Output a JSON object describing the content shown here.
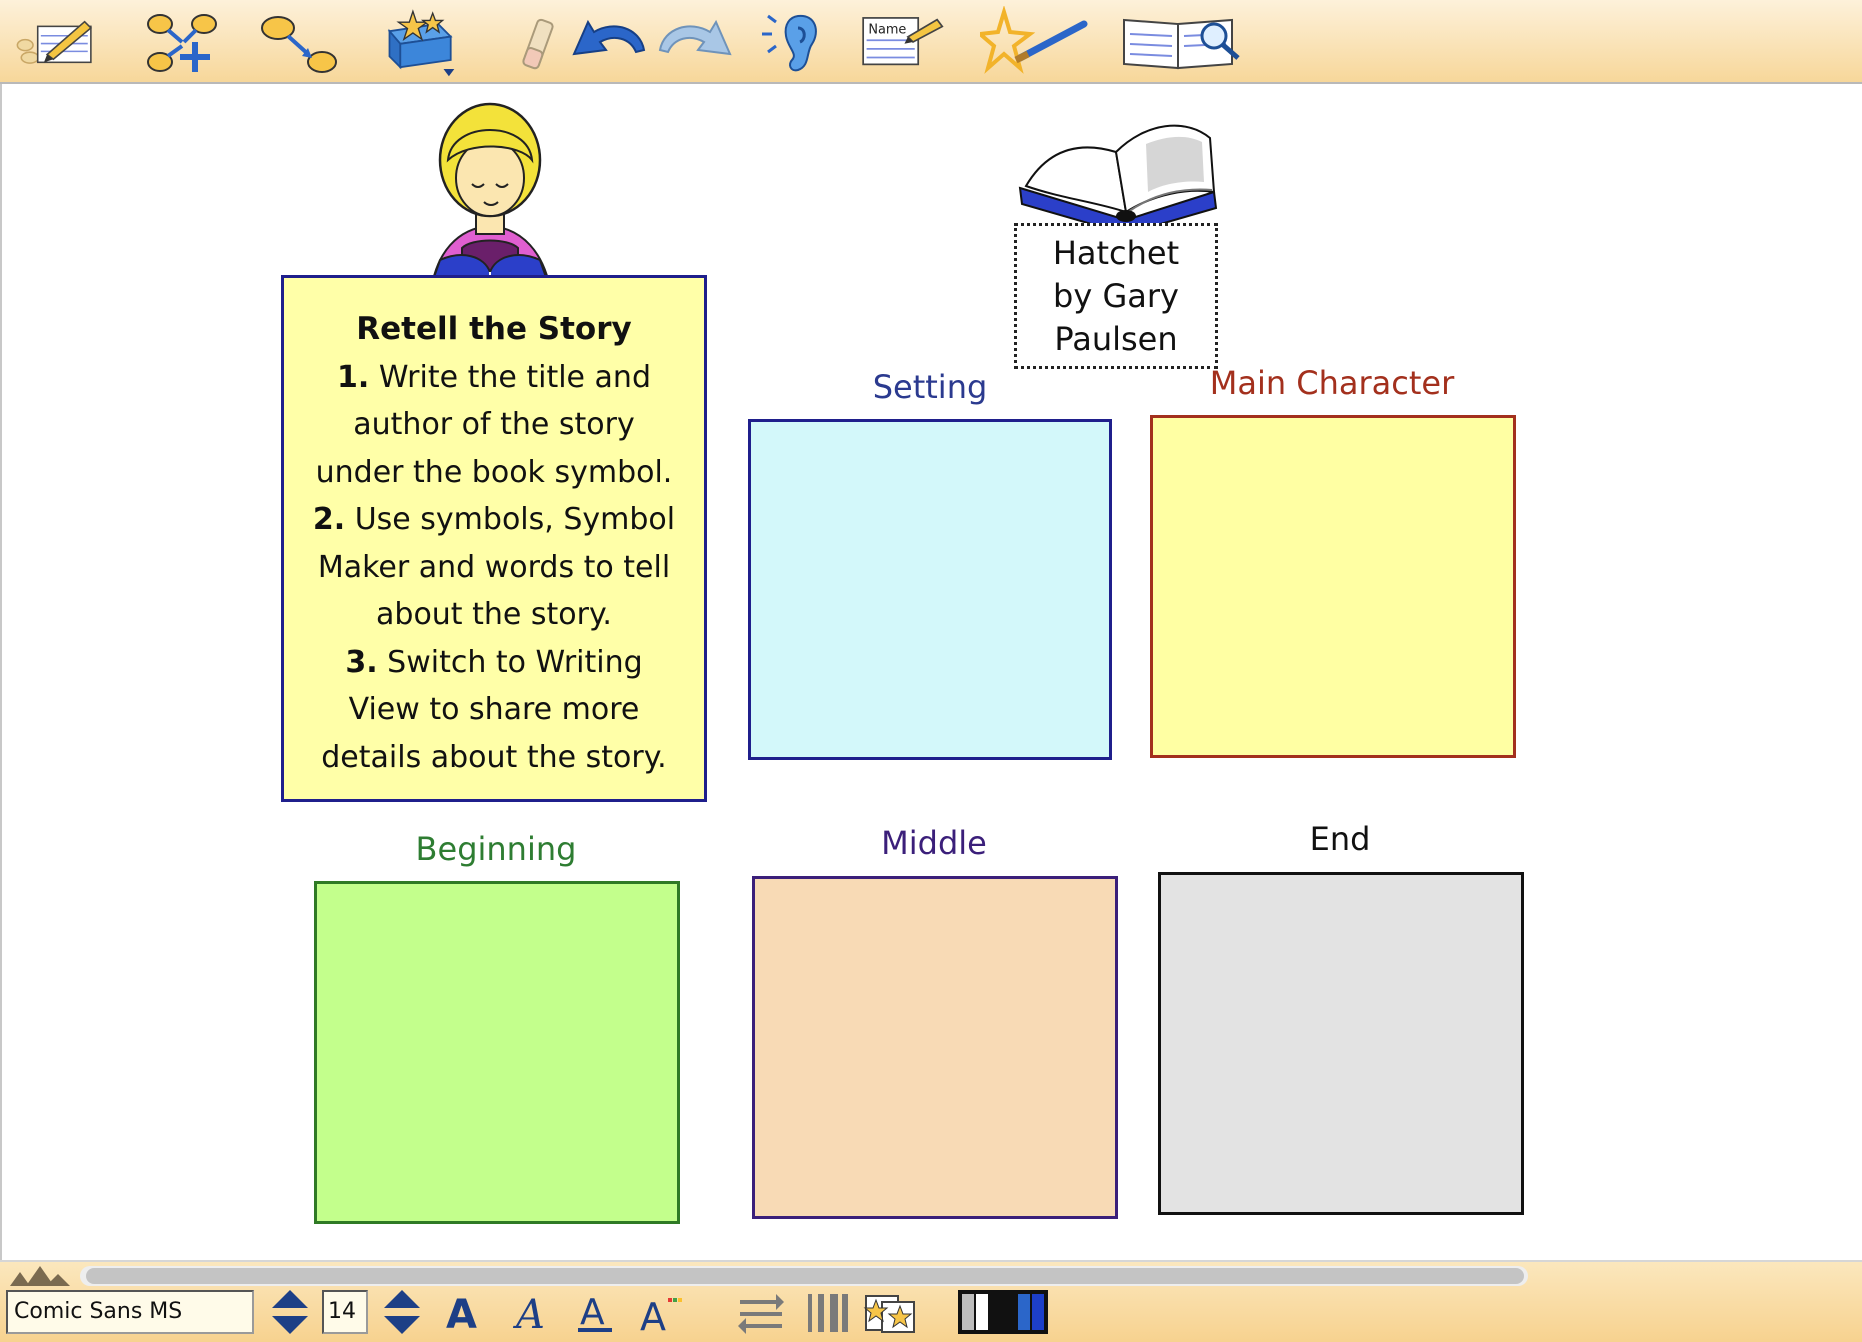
{
  "toolbar": {
    "icons": [
      "write-note-icon",
      "rapid-fire-icon",
      "create-link-icon",
      "symbols-icon",
      "eraser-icon",
      "undo-icon",
      "redo-icon",
      "listen-icon",
      "name-icon",
      "symbol-maker-icon",
      "writing-view-icon"
    ]
  },
  "instructions": {
    "title": "Retell the Story",
    "lines": [
      "Write the title and",
      "author of the story",
      "under the book symbol.",
      "Use symbols, Symbol",
      "Maker and words to tell",
      "about the story.",
      "Switch to Writing",
      "View to share more",
      "details about the story."
    ],
    "num1": "1.",
    "num2": "2.",
    "num3": "3."
  },
  "book": {
    "line1": "Hatchet",
    "line2": "by Gary",
    "line3": "Paulsen"
  },
  "boxes": {
    "setting": {
      "label": "Setting",
      "label_color": "#2b3a8f",
      "fill": "#d3f8fa",
      "border": "#1f1f8c"
    },
    "main_character": {
      "label": "Main Character",
      "label_color": "#a3301d",
      "fill": "#ffffa3",
      "border": "#a3301d"
    },
    "beginning": {
      "label": "Beginning",
      "label_color": "#2e7d32",
      "fill": "#c3ff8c",
      "border": "#2f7a25"
    },
    "middle": {
      "label": "Middle",
      "label_color": "#3b1f7a",
      "fill": "#f8dab5",
      "border": "#3b1f7a"
    },
    "end": {
      "label": "End",
      "label_color": "#111111",
      "fill": "#e3e3e3",
      "border": "#111111"
    }
  },
  "statusbar": {
    "font_name": "Comic Sans MS",
    "font_size": "14"
  }
}
